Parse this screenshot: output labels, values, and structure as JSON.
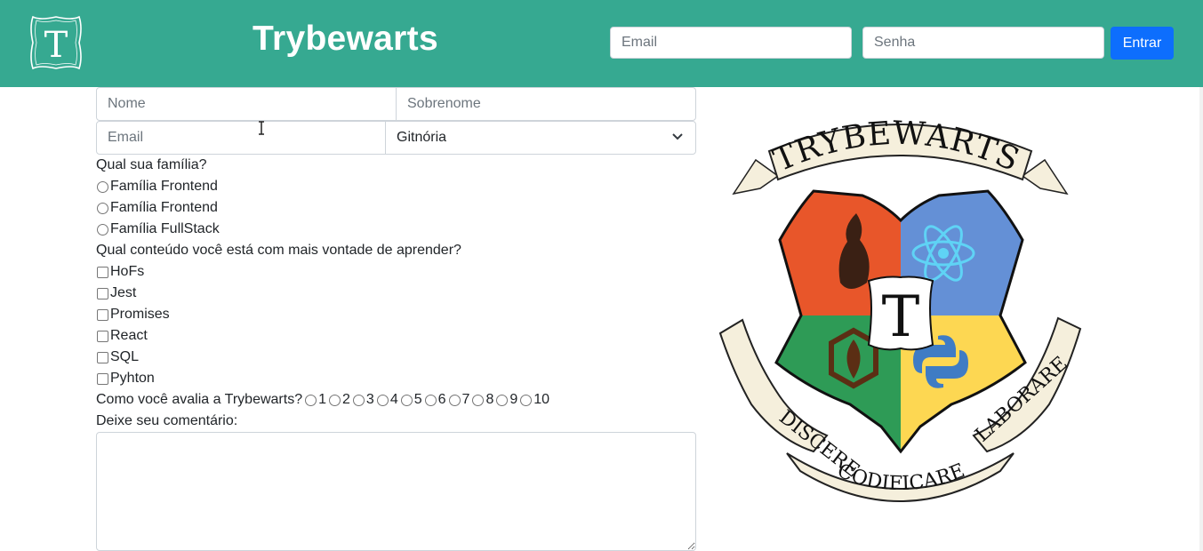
{
  "header": {
    "logo_letter": "T",
    "title": "Trybewarts",
    "email_placeholder": "Email",
    "password_placeholder": "Senha",
    "login_button": "Entrar"
  },
  "form": {
    "name_placeholder": "Nome",
    "lastname_placeholder": "Sobrenome",
    "email_placeholder": "Email",
    "house_selected": "Gitnória",
    "family_question": "Qual sua família?",
    "families": [
      "Família Frontend",
      "Família Frontend",
      "Família FullStack"
    ],
    "content_question": "Qual conteúdo você está com mais vontade de aprender?",
    "contents": [
      "HoFs",
      "Jest",
      "Promises",
      "React",
      "SQL",
      "Pyhton"
    ],
    "rating_question": "Como você avalia a Trybewarts?",
    "ratings": [
      "1",
      "2",
      "3",
      "4",
      "5",
      "6",
      "7",
      "8",
      "9",
      "10"
    ],
    "comment_label": "Deixe seu comentário:"
  },
  "crest": {
    "banner_top": "TRYBEWARTS",
    "center_letter": "T",
    "motto_left": "DISCERE",
    "motto_center": "CODIFICARE",
    "motto_right": "LABORARE"
  },
  "colors": {
    "header_bg": "#36a991",
    "button_bg": "#0d6efd",
    "crest_red": "#e8562a",
    "crest_blue": "#6490d6",
    "crest_green": "#2e9b56",
    "crest_yellow": "#fdd752"
  }
}
